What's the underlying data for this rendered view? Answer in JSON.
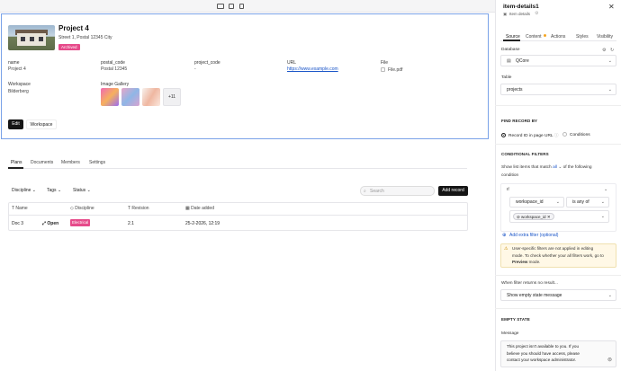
{
  "device_bar": {
    "icons": [
      "desktop-icon",
      "tablet-icon",
      "mobile-icon"
    ]
  },
  "header": {
    "title": "Project 4",
    "subtitle": "Street 1, Postal 12345 City",
    "badge": "Archived"
  },
  "fields": {
    "name_label": "name",
    "name_value": "Project 4",
    "postal_label": "postal_code",
    "postal_value": "Postal 12345",
    "project_code_label": "project_code",
    "project_code_value": "-",
    "url_label": "URL",
    "url_value": "https://www.example.com",
    "file_label": "File",
    "file_value": "File.pdf",
    "workspace_label": "Workspace",
    "workspace_value": "Bilderberg",
    "gallery_label": "Image Gallery",
    "gallery_more": "+11"
  },
  "actions": {
    "edit": "Edit",
    "workspace": "Workspace"
  },
  "tabs": [
    "Plans",
    "Documents",
    "Members",
    "Settings"
  ],
  "toolbar": {
    "discipline": "Discipline",
    "tags": "Tags",
    "status": "Status",
    "search_placeholder": "Search",
    "add_record": "Add record"
  },
  "table": {
    "headers": [
      "Name",
      "Discipline",
      "Revision",
      "Date added"
    ],
    "row": {
      "name": "Doc 3",
      "open": "Open",
      "discipline": "Electrical",
      "revision": "2.1",
      "date": "25-2-2026, 12:19"
    }
  },
  "panel": {
    "title": "item-details1",
    "subtitle": "Item details",
    "tabs": [
      "Source",
      "Content",
      "Actions",
      "Styles",
      "Visibility"
    ],
    "database_label": "Database",
    "database_value": "QCore",
    "table_label": "Table",
    "table_value": "projects",
    "find_record_heading": "FIND RECORD BY",
    "radio_record_id": "Record ID in page URL",
    "radio_conditions": "Conditions",
    "conditional_heading": "CONDITIONAL FILTERS",
    "show_items_text_1": "Show list items that match",
    "show_items_all": "all",
    "show_items_text_2": "of the following",
    "show_items_text_3": "condition",
    "if_label": "If",
    "cond_field": "workspace_id",
    "cond_op": "is any of",
    "cond_value": "workspace_id",
    "add_filter": "Add extra filter (optional)",
    "warn_line1": "User-specific filters are not applied in editing",
    "warn_line2": "mode. To check whether your all filters work, go to",
    "warn_bold": "Preview",
    "warn_line3": " mode.",
    "no_result_label": "When filter returns no result...",
    "no_result_value": "Show empty state message",
    "empty_state_heading": "EMPTY STATE",
    "message_label": "Message",
    "message_line1": "This project isn't available to you. If you",
    "message_line2": "believe you should have access, please",
    "message_line3": "contact your workspace administrator."
  },
  "colors": {
    "accent_pink": "#e64a8a",
    "link_blue": "#1a55c8",
    "selection_blue": "#7aa2e8"
  }
}
